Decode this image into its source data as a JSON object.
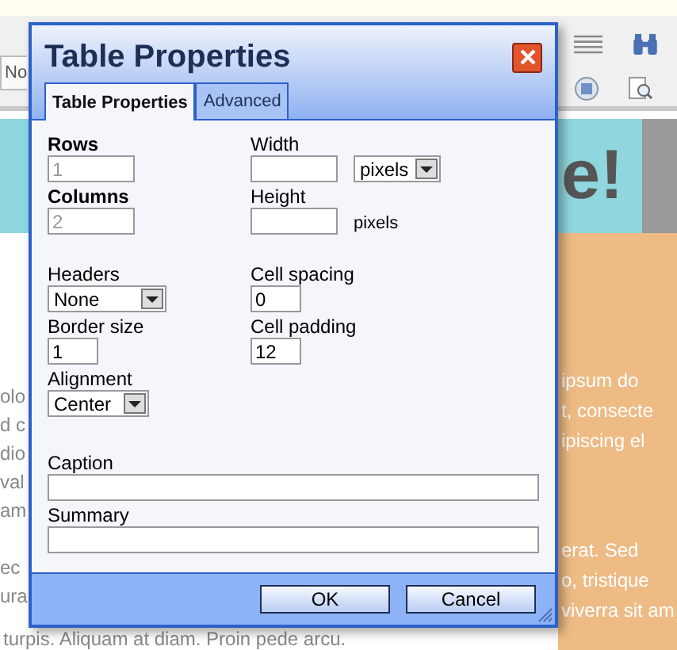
{
  "editor": {
    "toolbar_text": "No",
    "banner_text": "e!",
    "left_paragraphs": [
      [
        "olo",
        "d c",
        "dio",
        "val",
        "am"
      ],
      [
        "ec",
        "ura"
      ]
    ],
    "bottom_line": "turpis. Aliquam at diam. Proin pede arcu.",
    "right_paragraphs": [
      [
        "ipsum do",
        "t, consecte",
        "ipiscing el"
      ],
      [
        "erat. Sed",
        "o, tristique",
        "viverra sit am"
      ]
    ]
  },
  "dialog": {
    "title": "Table Properties",
    "tabs": [
      {
        "label": "Table Properties",
        "selected": true
      },
      {
        "label": "Advanced",
        "selected": false
      }
    ],
    "rows": {
      "label": "Rows",
      "value": "1",
      "disabled": true
    },
    "columns": {
      "label": "Columns",
      "value": "2",
      "disabled": true
    },
    "width": {
      "label": "Width",
      "unit": "pixels"
    },
    "height": {
      "label": "Height",
      "unit": "pixels"
    },
    "headers": {
      "label": "Headers",
      "value": "None"
    },
    "border_size": {
      "label": "Border size",
      "value": "1"
    },
    "alignment": {
      "label": "Alignment",
      "value": "Center"
    },
    "cell_spacing": {
      "label": "Cell spacing",
      "value": "0"
    },
    "cell_padding": {
      "label": "Cell padding",
      "value": "12"
    },
    "caption": {
      "label": "Caption"
    },
    "summary": {
      "label": "Summary"
    },
    "buttons": [
      "OK",
      "Cancel"
    ]
  }
}
